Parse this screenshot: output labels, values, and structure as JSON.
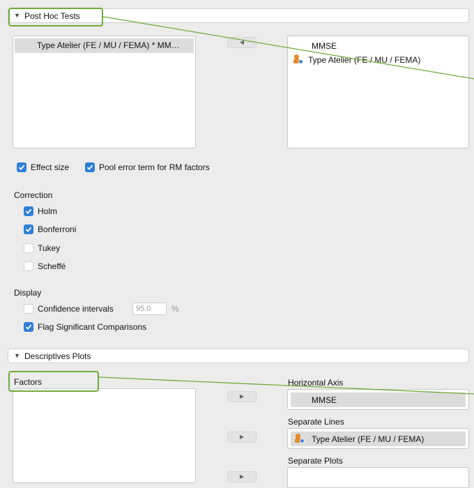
{
  "post_hoc": {
    "title": "Post Hoc Tests",
    "available": [
      "Type Atelier (FE / MU / FEMA) * MM…"
    ],
    "selected": [
      "MMSE",
      "Type Atelier (FE / MU / FEMA)"
    ],
    "options": {
      "effect_size": {
        "label": "Effect size",
        "checked": true
      },
      "pool_error": {
        "label": "Pool error term for RM factors",
        "checked": true
      }
    },
    "correction": {
      "heading": "Correction",
      "items": [
        {
          "label": "Holm",
          "checked": true
        },
        {
          "label": "Bonferroni",
          "checked": true
        },
        {
          "label": "Tukey",
          "checked": false
        },
        {
          "label": "Scheffé",
          "checked": false
        }
      ]
    },
    "display": {
      "heading": "Display",
      "ci_label": "Confidence intervals",
      "ci_value": "95.0",
      "ci_unit": "%",
      "ci_checked": false,
      "flag_label": "Flag Significant Comparisons",
      "flag_checked": true
    }
  },
  "descriptives": {
    "title": "Descriptives Plots",
    "factors_label": "Factors",
    "horizontal_axis": {
      "label": "Horizontal Axis",
      "value": "MMSE"
    },
    "separate_lines": {
      "label": "Separate Lines",
      "value": "Type Atelier (FE / MU / FEMA)"
    },
    "separate_plots": {
      "label": "Separate Plots",
      "value": ""
    }
  },
  "icons": {
    "collapse": "triangle-down-icon",
    "move_left": "arrow-left-icon",
    "move_right": "arrow-right-icon",
    "nominal_var": "nominal-variable-icon",
    "check": "checkmark-icon"
  },
  "colors": {
    "check_blue": "#2f7fd6",
    "callout_green": "#6cab3a",
    "nominal_orange": "#e58a2a",
    "nominal_blue": "#3c7fd8"
  }
}
